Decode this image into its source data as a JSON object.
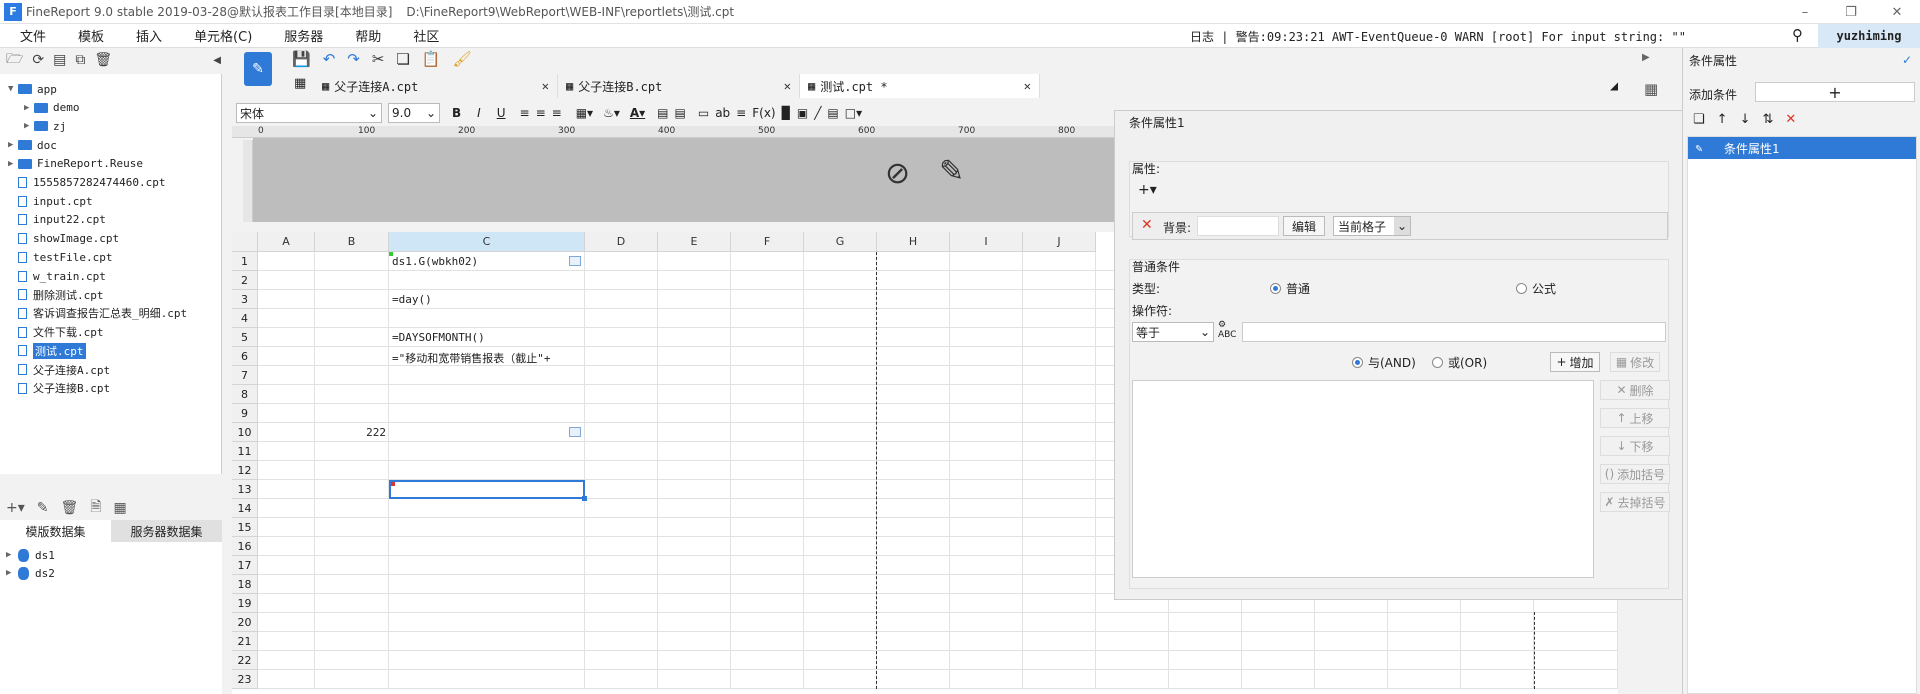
{
  "titlebar": {
    "title": "FineReport 9.0 stable 2019-03-28@默认报表工作目录[本地目录]",
    "path": "D:\\FineReport9\\WebReport\\WEB-INF\\reportlets\\测试.cpt"
  },
  "menu": [
    "文件",
    "模板",
    "插入",
    "单元格(C)",
    "服务器",
    "帮助",
    "社区"
  ],
  "log": "日志 | 警告:09:23:21 AWT-EventQueue-0 WARN [root] For input string: \"\"",
  "user": "yuzhiming",
  "tree": {
    "items": [
      {
        "label": "app",
        "type": "folder",
        "level": 0,
        "expanded": true
      },
      {
        "label": "demo",
        "type": "folder",
        "level": 1,
        "expanded": false
      },
      {
        "label": "zj",
        "type": "folder",
        "level": 1,
        "expanded": false
      },
      {
        "label": "doc",
        "type": "folder",
        "level": 0,
        "expanded": false
      },
      {
        "label": "FineReport.Reuse",
        "type": "folder",
        "level": 0,
        "expanded": false
      },
      {
        "label": "1555857282474460.cpt",
        "type": "file",
        "level": 0
      },
      {
        "label": "input.cpt",
        "type": "file",
        "level": 0
      },
      {
        "label": "input22.cpt",
        "type": "file",
        "level": 0
      },
      {
        "label": "showImage.cpt",
        "type": "file",
        "level": 0
      },
      {
        "label": "testFile.cpt",
        "type": "file",
        "level": 0
      },
      {
        "label": "w_train.cpt",
        "type": "file",
        "level": 0
      },
      {
        "label": "删除测试.cpt",
        "type": "file",
        "level": 0
      },
      {
        "label": "客诉调查报告汇总表_明细.cpt",
        "type": "file",
        "level": 0
      },
      {
        "label": "文件下载.cpt",
        "type": "file",
        "level": 0
      },
      {
        "label": "测试.cpt",
        "type": "file",
        "level": 0,
        "selected": true
      },
      {
        "label": "父子连接A.cpt",
        "type": "file",
        "level": 0
      },
      {
        "label": "父子连接B.cpt",
        "type": "file",
        "level": 0
      }
    ]
  },
  "datasets": {
    "tabs": [
      "模版数据集",
      "服务器数据集"
    ],
    "items": [
      "ds1",
      "ds2"
    ]
  },
  "tabs": [
    {
      "label": "父子连接A.cpt",
      "active": false
    },
    {
      "label": "父子连接B.cpt",
      "active": false
    },
    {
      "label": "测试.cpt *",
      "active": true
    }
  ],
  "format": {
    "font": "宋体",
    "size": "9.0"
  },
  "ruler": [
    "0",
    "100",
    "200",
    "300",
    "400",
    "500",
    "600",
    "700",
    "800"
  ],
  "grid": {
    "columns": [
      "A",
      "B",
      "C",
      "D",
      "E",
      "F",
      "G",
      "H",
      "I",
      "J"
    ],
    "rows": [
      "1",
      "2",
      "3",
      "4",
      "5",
      "6",
      "7",
      "8",
      "9",
      "10",
      "11",
      "12",
      "13",
      "14",
      "15",
      "16",
      "17",
      "18",
      "19",
      "20",
      "21",
      "22",
      "23"
    ],
    "cells": {
      "c1": "ds1.G(wbkh02)",
      "c3": "=day()",
      "c5": "=DAYSOFMONTH()",
      "c6": "=\"移动和宽带销售报表（截止\"+",
      "b10": "222"
    }
  },
  "cond": {
    "title": "条件属性1",
    "attr_label": "属性:",
    "bg_label": "背景:",
    "edit_label": "编辑",
    "scope_value": "当前格子",
    "normal_cond_label": "普通条件",
    "type_label": "类型:",
    "type_normal": "普通",
    "type_formula": "公式",
    "operator_label": "操作符:",
    "operator_value": "等于",
    "and_label": "与(AND)",
    "or_label": "或(OR)",
    "add_label": "增加",
    "modify_label": "修改",
    "delete_label": "删除",
    "up_label": "上移",
    "down_label": "下移",
    "add_bracket_label": "添加括号",
    "remove_bracket_label": "去掉括号"
  },
  "rpanel": {
    "title": "条件属性",
    "add_label": "添加条件",
    "item": "条件属性1"
  }
}
